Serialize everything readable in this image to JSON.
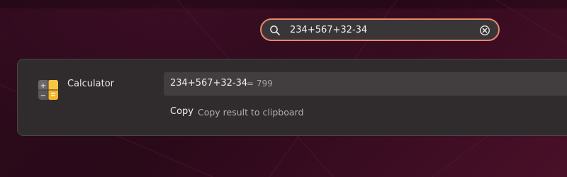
{
  "search": {
    "query": "234+567+32-34",
    "icon": "search-icon",
    "clear_icon": "clear-icon"
  },
  "provider": {
    "name": "Calculator",
    "icon": "calculator-icon"
  },
  "results": [
    {
      "title": "234+567+32-34",
      "subtitle": "= 799"
    },
    {
      "title": "Copy",
      "subtitle": "Copy result to clipboard"
    }
  ],
  "colors": {
    "accent": "#e9876b",
    "panel": "#302c2d",
    "selected": "#423d3e",
    "background": "#2c0a1c"
  }
}
